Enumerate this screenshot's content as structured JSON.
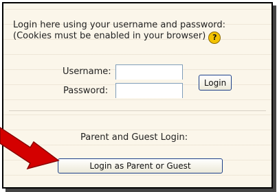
{
  "login": {
    "line1": "Login here using your username and password:",
    "line2": "(Cookies must be enabled in your browser)",
    "help_icon": "question-mark-icon",
    "username_label": "Username:",
    "password_label": "Password:",
    "username_value": "",
    "password_value": "",
    "login_button": "Login"
  },
  "guest": {
    "heading": "Parent and Guest Login:",
    "button": "Login as Parent or Guest"
  },
  "colors": {
    "arrow": "#d40000",
    "help_icon": "#f3c200",
    "panel_bg": "#fbf6ea"
  }
}
